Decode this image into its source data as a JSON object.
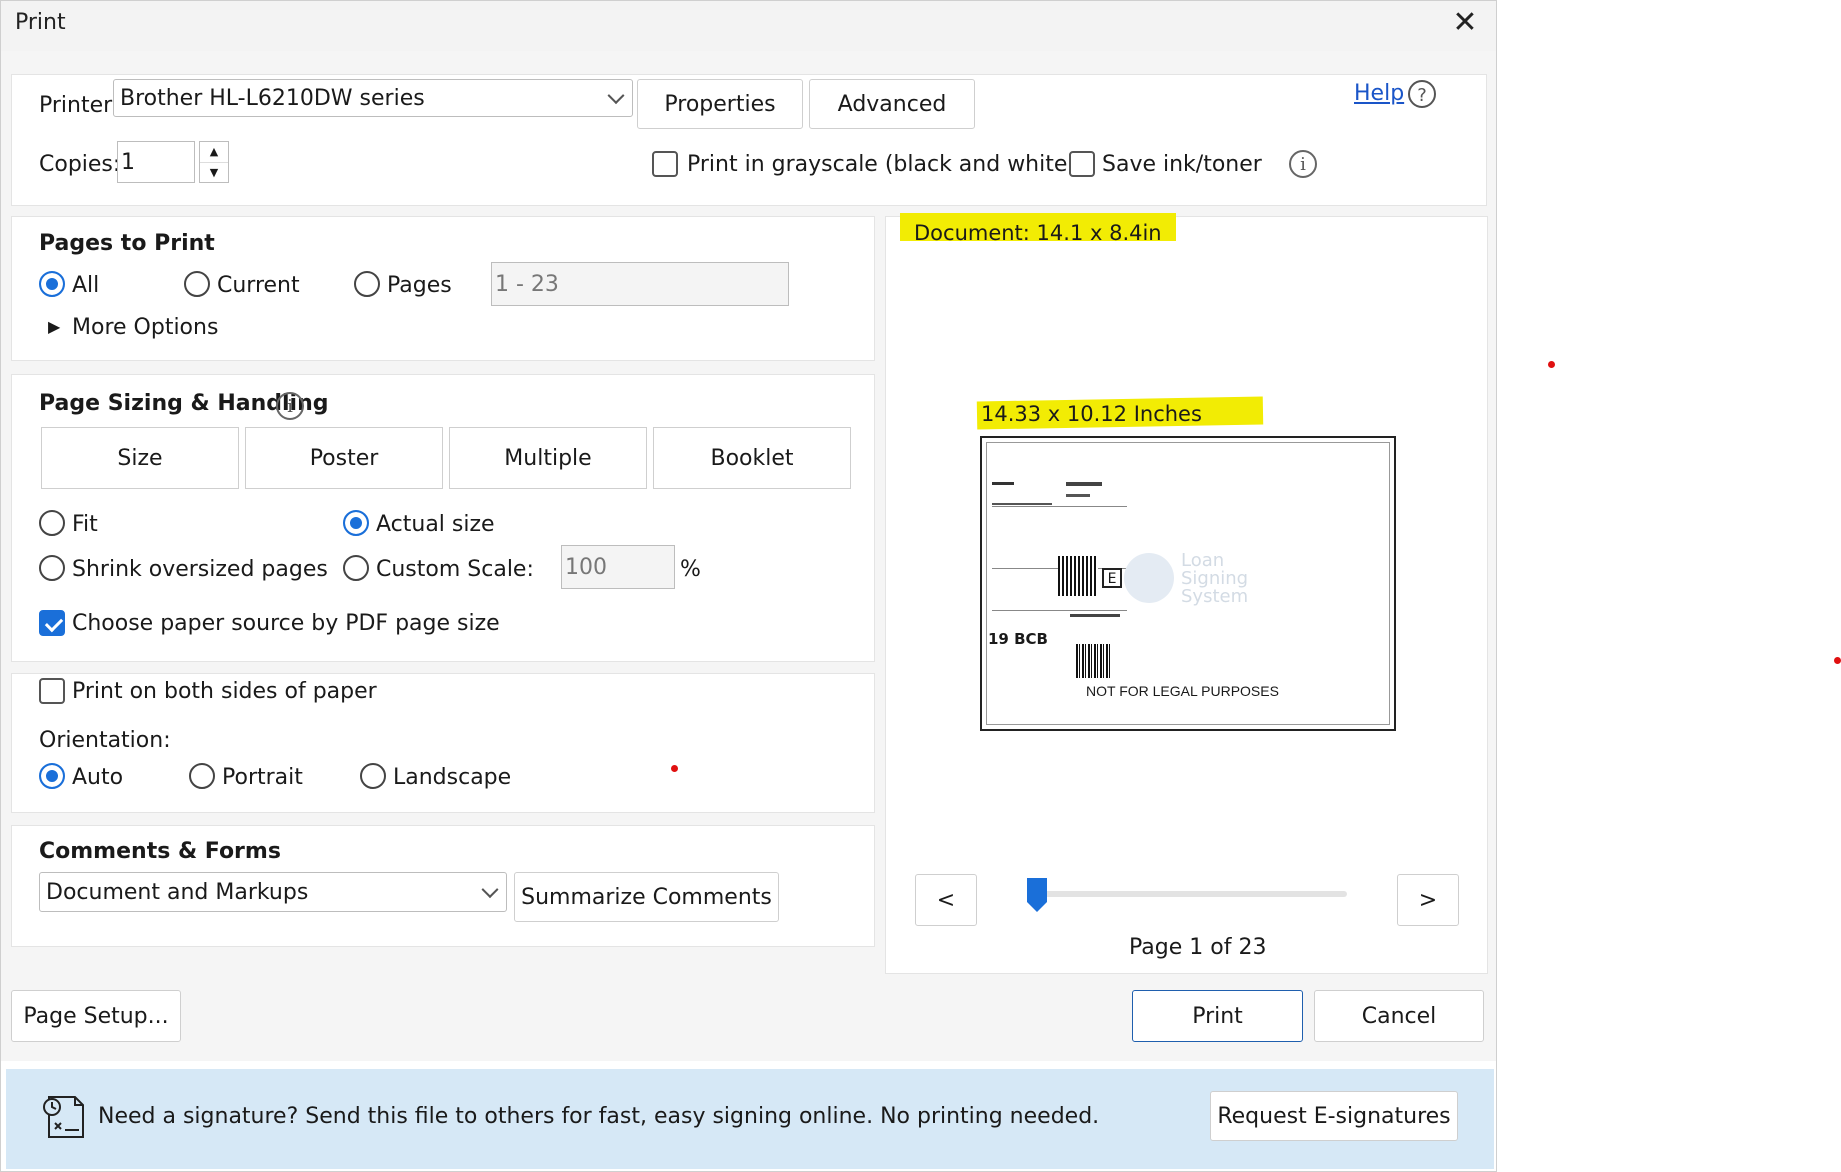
{
  "window": {
    "title": "Print"
  },
  "printer": {
    "label": "Printer:",
    "selected": "Brother HL-L6210DW series",
    "properties_label": "Properties",
    "advanced_label": "Advanced",
    "help_label": "Help",
    "copies_label": "Copies:",
    "copies_value": "1",
    "grayscale_label": "Print in grayscale (black and white)",
    "save_ink_label": "Save ink/toner"
  },
  "pages_to_print": {
    "title": "Pages to Print",
    "all_label": "All",
    "current_label": "Current",
    "pages_label": "Pages",
    "pages_range": "1 - 23",
    "more_options_label": "More Options",
    "selected": "All"
  },
  "page_sizing": {
    "title": "Page Sizing & Handling",
    "tabs": [
      "Size",
      "Poster",
      "Multiple",
      "Booklet"
    ],
    "fit_label": "Fit",
    "actual_size_label": "Actual size",
    "shrink_label": "Shrink oversized pages",
    "custom_scale_label": "Custom Scale:",
    "custom_scale_value": "100",
    "percent_sign": "%",
    "paper_source_label": "Choose paper source by PDF page size",
    "paper_source_checked": true
  },
  "duplex": {
    "both_sides_label": "Print on both sides of paper",
    "orientation_label": "Orientation:",
    "auto_label": "Auto",
    "portrait_label": "Portrait",
    "landscape_label": "Landscape"
  },
  "comments_forms": {
    "title": "Comments & Forms",
    "selected": "Document and Markups",
    "summarize_label": "Summarize Comments"
  },
  "preview": {
    "document_size": "Document: 14.1 x 8.4in",
    "paper_size": "14.33 x 10.12 Inches",
    "thumb": {
      "code": "19 BCB",
      "watermark_line1": "Loan",
      "watermark_line2": "Signing",
      "watermark_line3": "System",
      "footer_text": "NOT FOR LEGAL PURPOSES"
    },
    "prev_label": "<",
    "next_label": ">",
    "page_indicator": "Page 1 of 23",
    "slider_fraction": 0.0
  },
  "footer": {
    "page_setup_label": "Page Setup...",
    "print_label": "Print",
    "cancel_label": "Cancel"
  },
  "banner": {
    "message": "Need a signature? Send this file to others for fast, easy signing online. No printing needed.",
    "request_label": "Request E-signatures"
  },
  "colors": {
    "accent": "#1a6fd9",
    "highlight": "#f2ec04",
    "banner_bg": "#d6e8f6"
  }
}
